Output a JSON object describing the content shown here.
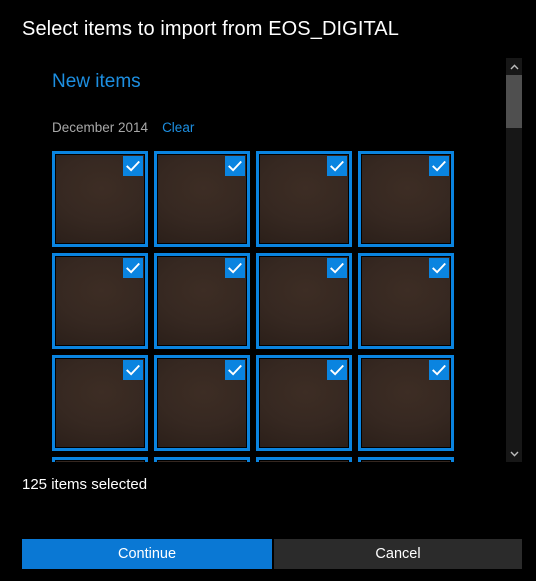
{
  "dialog": {
    "title": "Select items to import from EOS_DIGITAL"
  },
  "content": {
    "group_header": "New items",
    "date_label": "December 2014",
    "clear_label": "Clear"
  },
  "grid": {
    "columns": 4,
    "tiles": [
      {
        "selected": true,
        "checkmark_icon": "checkmark-icon"
      },
      {
        "selected": true,
        "checkmark_icon": "checkmark-icon"
      },
      {
        "selected": true,
        "checkmark_icon": "checkmark-icon"
      },
      {
        "selected": true,
        "checkmark_icon": "checkmark-icon"
      },
      {
        "selected": true,
        "checkmark_icon": "checkmark-icon"
      },
      {
        "selected": true,
        "checkmark_icon": "checkmark-icon"
      },
      {
        "selected": true,
        "checkmark_icon": "checkmark-icon"
      },
      {
        "selected": true,
        "checkmark_icon": "checkmark-icon"
      },
      {
        "selected": true,
        "checkmark_icon": "checkmark-icon"
      },
      {
        "selected": true,
        "checkmark_icon": "checkmark-icon"
      },
      {
        "selected": true,
        "checkmark_icon": "checkmark-icon"
      },
      {
        "selected": true,
        "checkmark_icon": "checkmark-icon"
      },
      {
        "selected": true,
        "checkmark_icon": "checkmark-icon"
      },
      {
        "selected": true,
        "checkmark_icon": "checkmark-icon"
      },
      {
        "selected": true,
        "checkmark_icon": "checkmark-icon"
      },
      {
        "selected": true,
        "checkmark_icon": "checkmark-icon"
      }
    ]
  },
  "scrollbar": {
    "up_arrow_icon": "chevron-up-icon",
    "down_arrow_icon": "chevron-down-icon"
  },
  "status": {
    "text": "125 items selected"
  },
  "footer": {
    "continue_label": "Continue",
    "cancel_label": "Cancel"
  },
  "colors": {
    "accent": "#0a84e0",
    "primary_button": "#0a78d4",
    "secondary_button": "#2b2b2b",
    "link": "#1d8fe1",
    "background": "#000000",
    "muted_text": "#a8a8a8",
    "photo_tone": "#362821",
    "scrollbar_thumb": "#4f4f4f",
    "scrollbar_track": "#171717"
  }
}
